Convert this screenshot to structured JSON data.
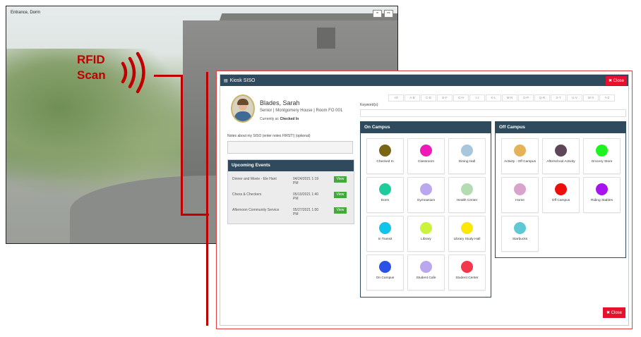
{
  "background": {
    "title": "Entrance, Dorm",
    "icons": [
      "wifi-icon",
      "exit-icon"
    ]
  },
  "rfid": {
    "line1": "RFID",
    "line2": "Scan",
    "color": "#c00000"
  },
  "modal": {
    "title": "Kiosk SISO",
    "close_label": "Close",
    "header_color": "#2e4a5c",
    "close_color": "#e8112d"
  },
  "person": {
    "name": "Blades, Sarah",
    "details": "Senior | Montgomery House | Room FO 001",
    "status_prefix": "Currently at:",
    "status_value": "Checked In"
  },
  "notes": {
    "label": "Notes about my SISO (enter notes FIRST!) (optional)"
  },
  "events": {
    "title": "Upcoming Events",
    "view_label": "View",
    "items": [
      {
        "name": "Dinner and Movie - Ele Hant",
        "date": "04/24/2021 1:19 PM"
      },
      {
        "name": "Chess & Checkers",
        "date": "05/10/2021 1:40 PM"
      },
      {
        "name": "Afternoon Community Service",
        "date": "05/27/2021 1:00 PM"
      }
    ]
  },
  "alphabet": [
    "All",
    "A-B",
    "C-D",
    "E-F",
    "G-H",
    "I-J",
    "K-L",
    "M-N",
    "O-P",
    "Q-R",
    "S-T",
    "U-V",
    "W-X",
    "Y-Z"
  ],
  "keywords_label": "Keyword(s):",
  "on_campus": {
    "title": "On Campus",
    "locations": [
      {
        "label": "Checked In",
        "color": "#7a6416"
      },
      {
        "label": "Classroom",
        "color": "#ee1ab8"
      },
      {
        "label": "Dining Hall",
        "color": "#a6c7dc"
      },
      {
        "label": "Dorm",
        "color": "#1fcb9b"
      },
      {
        "label": "Gymnasium",
        "color": "#bba7f0"
      },
      {
        "label": "Health Center",
        "color": "#b4dcb2"
      },
      {
        "label": "In Transit",
        "color": "#10c5ea"
      },
      {
        "label": "Library",
        "color": "#caf33a"
      },
      {
        "label": "Library Study Hall",
        "color": "#fbe708"
      },
      {
        "label": "On Campus",
        "color": "#2a52e8"
      },
      {
        "label": "Student Cafe",
        "color": "#bba7f0"
      },
      {
        "label": "Student Center",
        "color": "#f2384a"
      }
    ]
  },
  "off_campus": {
    "title": "Off Campus",
    "locations": [
      {
        "label": "Activity - Off Campus",
        "color": "#e5b257"
      },
      {
        "label": "Afterschool Activity",
        "color": "#5e4658"
      },
      {
        "label": "Grocery Store",
        "color": "#1ff31f"
      },
      {
        "label": "Home",
        "color": "#d9a4cc"
      },
      {
        "label": "Off Campus",
        "color": "#ee0d0d"
      },
      {
        "label": "Riding Stables",
        "color": "#a712f0"
      },
      {
        "label": "Starbucks",
        "color": "#5fc8d4"
      }
    ]
  }
}
